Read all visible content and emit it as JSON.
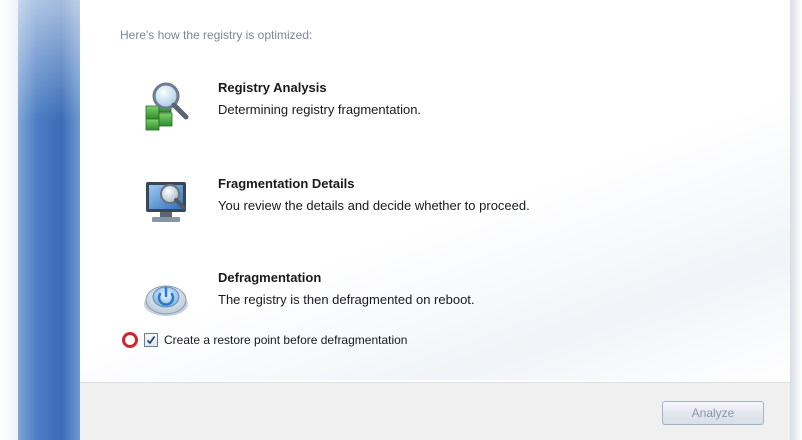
{
  "intro_text": "Here's how the registry is optimized:",
  "steps": [
    {
      "title": "Registry Analysis",
      "description": "Determining registry fragmentation.",
      "icon": "registry-analysis-icon"
    },
    {
      "title": "Fragmentation Details",
      "description": "You review the details and decide whether to proceed.",
      "icon": "monitor-details-icon"
    },
    {
      "title": "Defragmentation",
      "description": "The registry is then defragmented on reboot.",
      "icon": "power-button-icon"
    }
  ],
  "restore_point": {
    "label": "Create a restore point before defragmentation",
    "checked": true
  },
  "footer": {
    "analyze_label": "Analyze"
  },
  "colors": {
    "sidebar_blue": "#3a6cb6",
    "highlight_ring": "#d3262b",
    "intro_text": "#7a8799"
  }
}
